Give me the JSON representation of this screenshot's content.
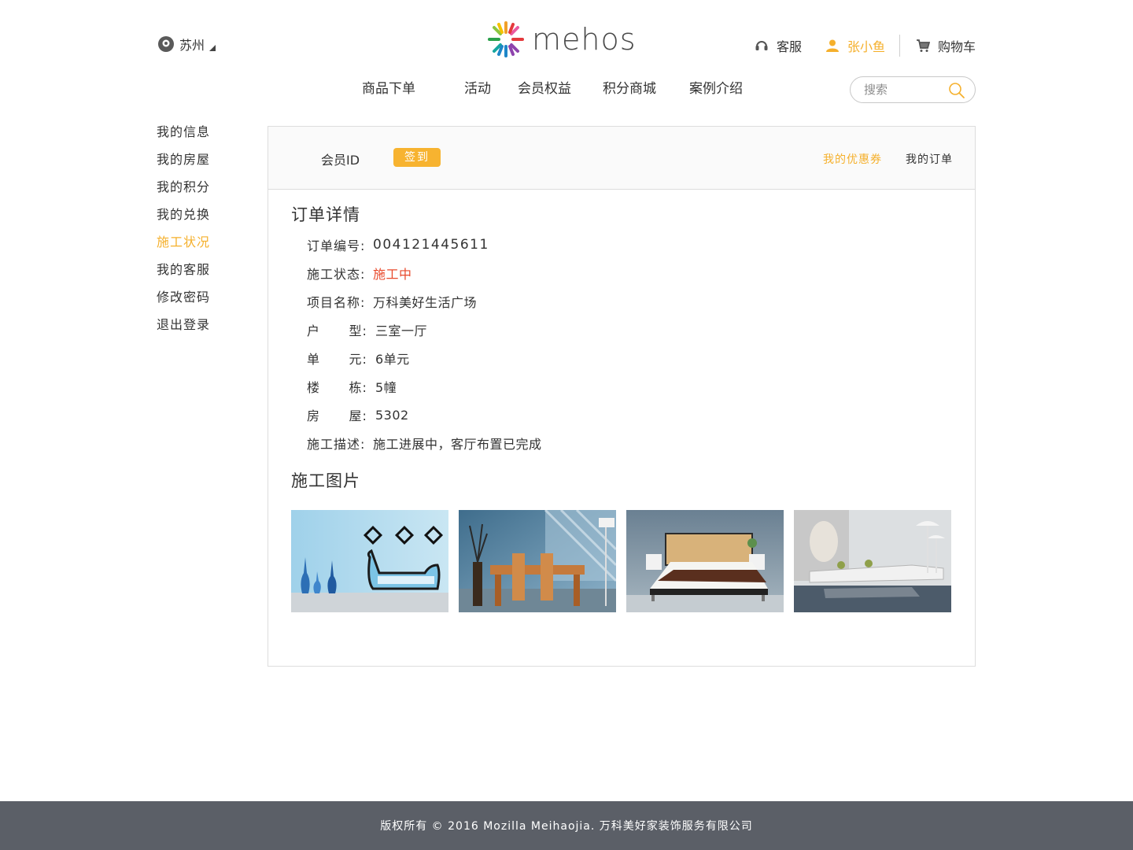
{
  "header": {
    "city": "苏州",
    "logo_text": "mehos",
    "service_label": "客服",
    "user_name": "张小鱼",
    "cart_label": "购物车",
    "search_placeholder": "搜索"
  },
  "nav": {
    "items": [
      "商品下单",
      "活动",
      "会员权益",
      "积分商城",
      "案例介绍"
    ]
  },
  "sidebar": {
    "items": [
      {
        "label": "我的信息",
        "active": false
      },
      {
        "label": "我的房屋",
        "active": false
      },
      {
        "label": "我的积分",
        "active": false
      },
      {
        "label": "我的兑换",
        "active": false
      },
      {
        "label": "施工状况",
        "active": true
      },
      {
        "label": "我的客服",
        "active": false
      },
      {
        "label": "修改密码",
        "active": false
      },
      {
        "label": "退出登录",
        "active": false
      }
    ]
  },
  "member": {
    "id_label": "会员ID",
    "signin_label": "签到",
    "coupon_link": "我的优惠券",
    "orders_link": "我的订单"
  },
  "order": {
    "title": "订单详情",
    "fields": [
      {
        "label": "订单编号:",
        "value": "004121445611"
      },
      {
        "label": "施工状态:",
        "value": "施工中"
      },
      {
        "label": "项目名称:",
        "value": "万科美好生活广场"
      },
      {
        "label": "户      型:",
        "value": "三室一厅"
      },
      {
        "label": "单      元:",
        "value": "6单元"
      },
      {
        "label": "楼      栋:",
        "value": "5幢"
      },
      {
        "label": "房      屋:",
        "value": "5302"
      },
      {
        "label": "施工描述:",
        "value": "施工进展中，客厅布置已完成"
      }
    ]
  },
  "photos": {
    "title": "施工图片",
    "items": [
      "living-room-sofa-photo",
      "dining-room-photo",
      "bedroom-photo",
      "lounge-photo"
    ]
  },
  "footer": {
    "copyright": "版权所有 © 2016 Mozilla Meihaojia. 万科美好家装饰服务有限公司"
  },
  "colors": {
    "accent": "#f5b02c",
    "status": "#e84a2c",
    "footer_bg": "#5b5f67"
  }
}
